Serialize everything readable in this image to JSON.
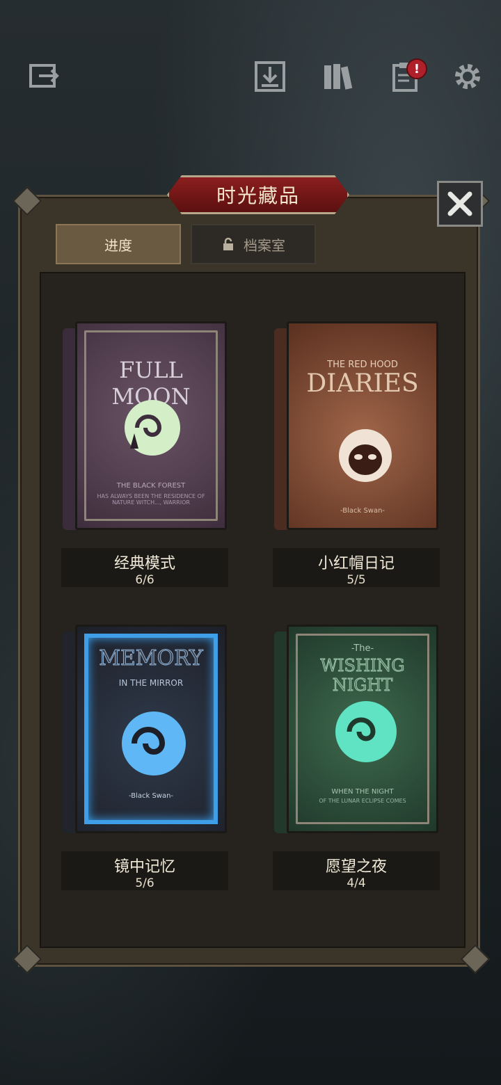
{
  "window": {
    "title": "时光藏品"
  },
  "top_icons": [
    "exit-icon",
    "download-icon",
    "books-icon",
    "clipboard-icon",
    "gear-icon"
  ],
  "badge": "!",
  "tabs": [
    {
      "label": "进度",
      "active": true
    },
    {
      "label": "档案室",
      "active": false,
      "locked": true
    }
  ],
  "books": [
    {
      "cover_title": "FULL MOON",
      "cover_sub": "THE BLACK FOREST",
      "cover_text": "HAS ALWAYS BEEN THE RESIDENCE OF NATURE WITCH..., WARRIOR",
      "name": "经典模式",
      "progress": "6/6",
      "color": "#4a3848"
    },
    {
      "cover_title": "DIARIES",
      "cover_top": "THE RED HOOD",
      "cover_sub": "-Black Swan-",
      "name": "小红帽日记",
      "progress": "5/5",
      "color": "#6a3a28"
    },
    {
      "cover_title": "MEMORY",
      "cover_top": "IN THE MIRROR",
      "cover_sub": "-Black Swan-",
      "name": "镜中记忆",
      "progress": "5/6",
      "color": "#2a2e3a"
    },
    {
      "cover_title": "WISHING NIGHT",
      "cover_top": "-The-",
      "cover_sub": "WHEN THE NIGHT",
      "cover_text": "OF THE LUNAR ECLIPSE COMES",
      "name": "愿望之夜",
      "progress": "4/4",
      "color": "#2c4a36"
    }
  ]
}
